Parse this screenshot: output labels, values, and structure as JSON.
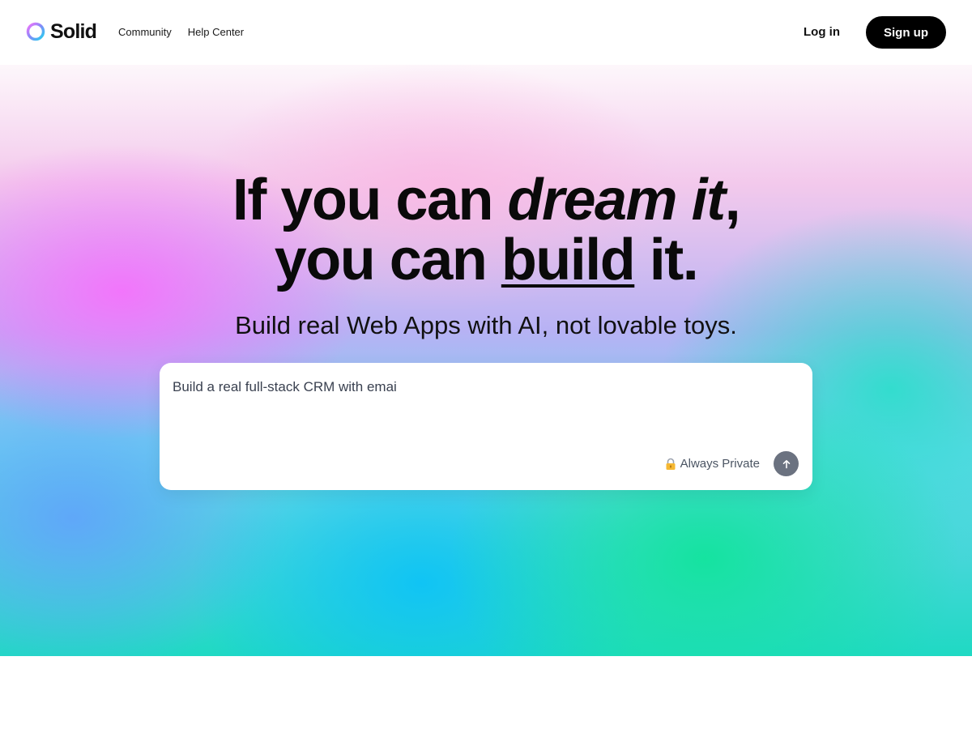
{
  "header": {
    "brand": "Solid",
    "nav": [
      {
        "label": "Community"
      },
      {
        "label": "Help Center"
      }
    ],
    "login_label": "Log in",
    "signup_label": "Sign up"
  },
  "hero": {
    "headline_part1": "If you can ",
    "headline_emph": "dream it",
    "headline_part2": ",",
    "headline_part3": "you can ",
    "headline_underline": "build",
    "headline_part4": " it.",
    "subhead": "Build real Web Apps with AI, not lovable toys.",
    "prompt": {
      "value": "Build a real full-stack CRM with emai",
      "privacy_label": "Always Private"
    }
  },
  "icons": {
    "logo": "solid-ring-logo",
    "privacy": "lock-icon",
    "submit": "arrow-up-icon"
  },
  "colors": {
    "signup_bg": "#000000",
    "send_button": "#6b7280",
    "accent_pink": "#f472fc",
    "accent_green": "#15e3a0",
    "accent_blue": "#0ec3f6"
  }
}
